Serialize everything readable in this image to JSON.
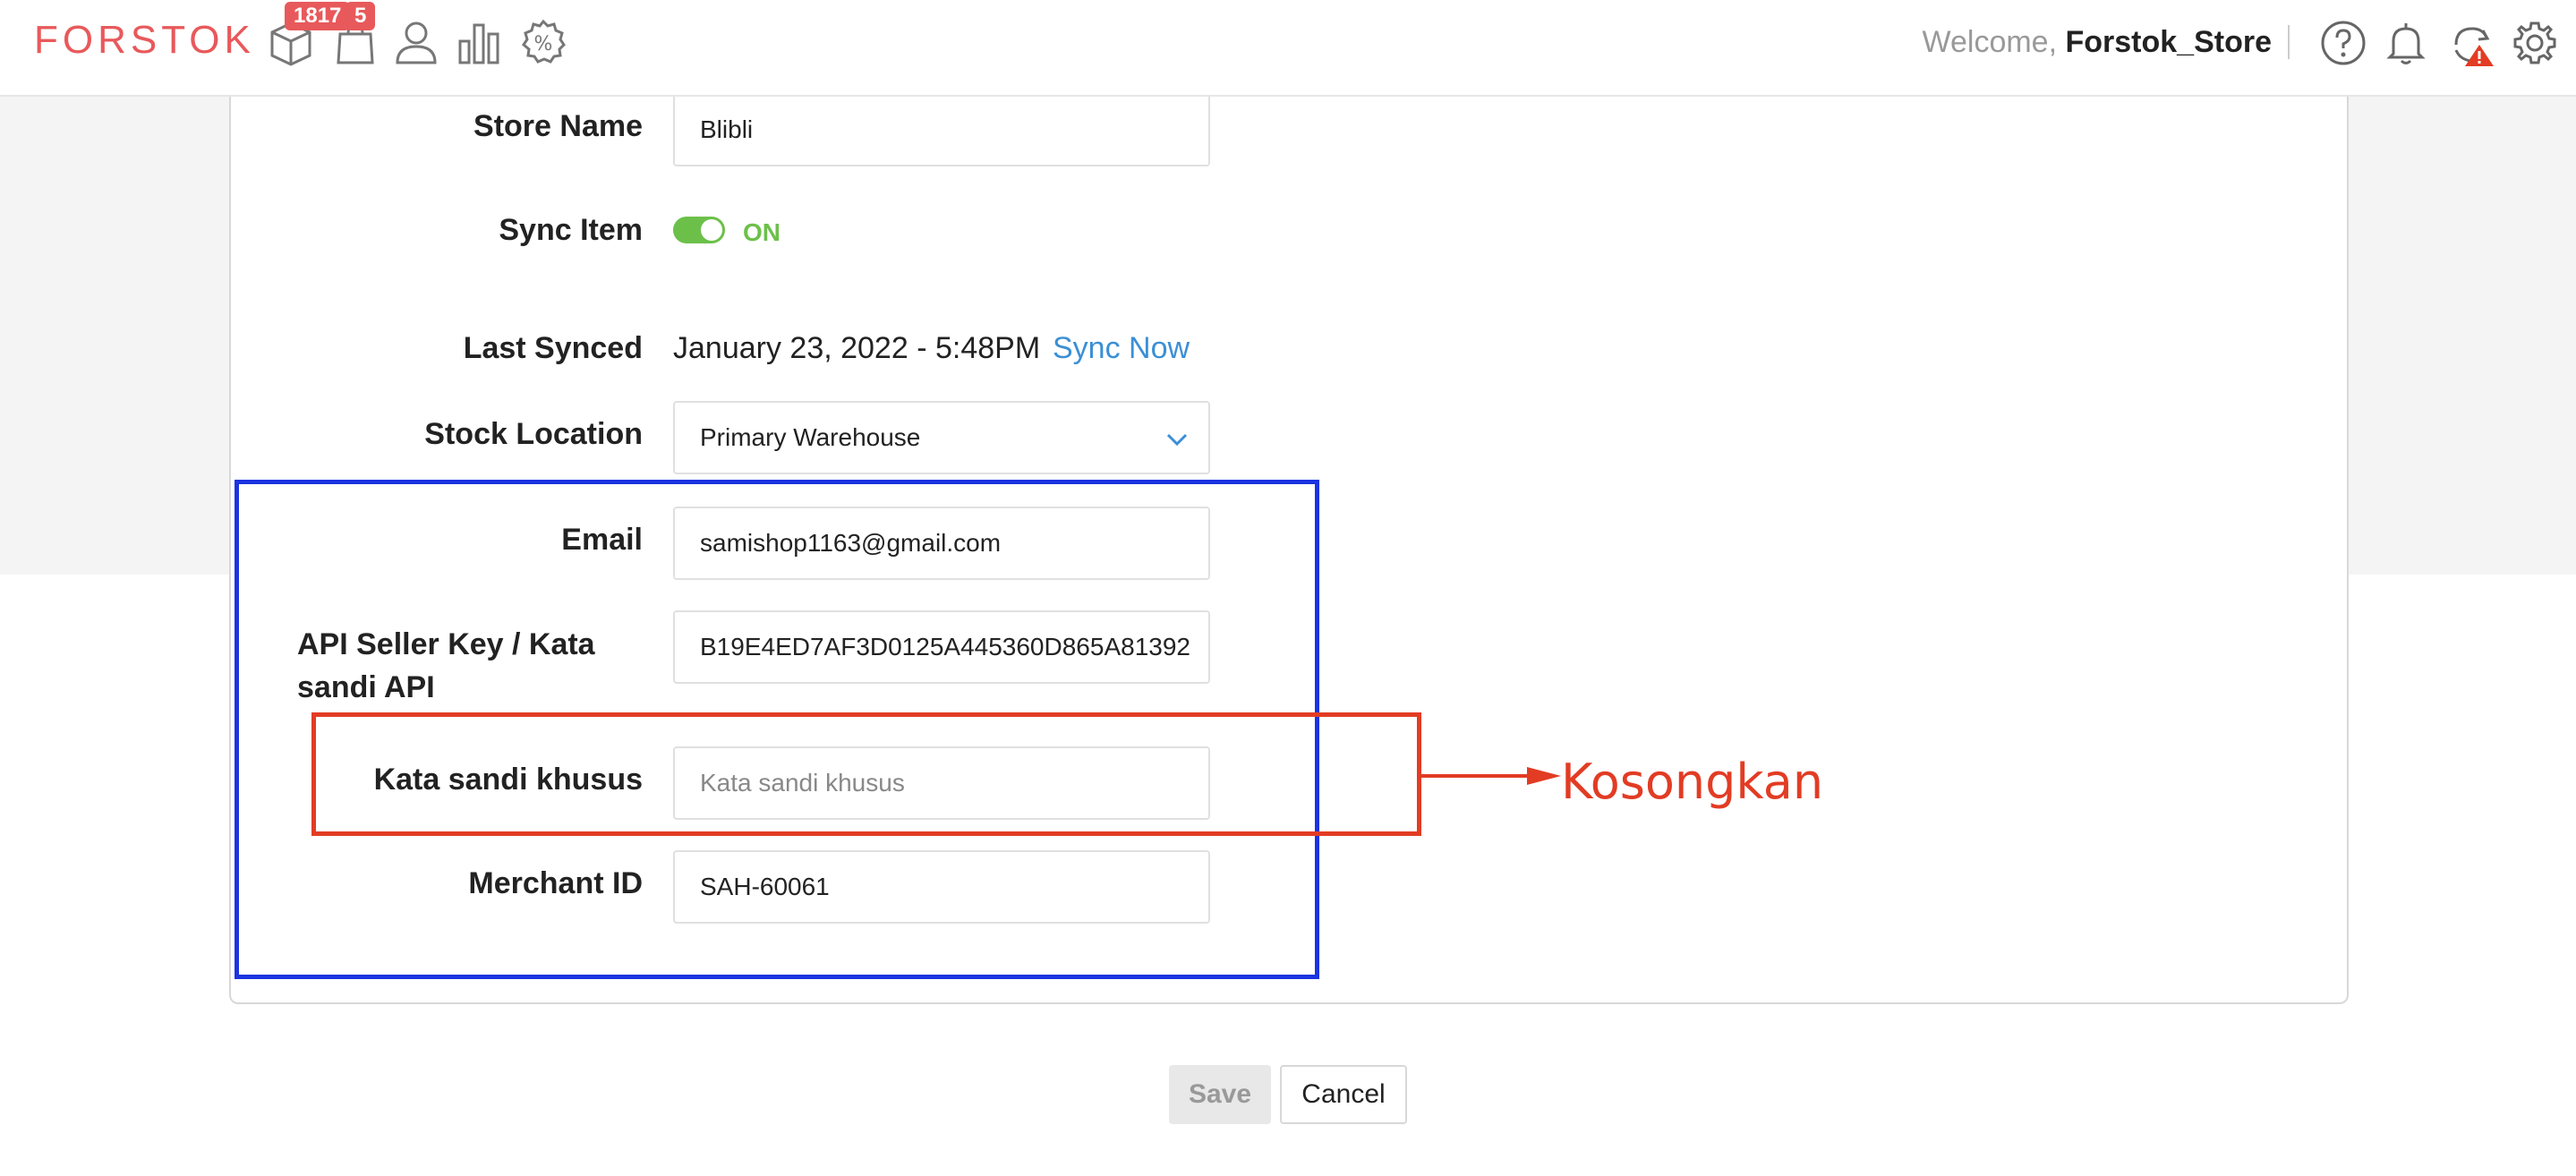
{
  "header": {
    "logo": "FORSTOK",
    "badges": {
      "orders": "1817",
      "bag": "5"
    },
    "welcome_prefix": "Welcome, ",
    "username": "Forstok_Store"
  },
  "form": {
    "store_name_label": "Store Name",
    "store_name_value": "Blibli",
    "sync_item_label": "Sync Item",
    "sync_item_state": "ON",
    "last_synced_label": "Last Synced",
    "last_synced_value": "January 23, 2022 - 5:48PM",
    "sync_now": "Sync Now",
    "stock_location_label": "Stock Location",
    "stock_location_value": "Primary Warehouse",
    "email_label": "Email",
    "email_value": "samishop1163@gmail.com",
    "api_key_label": "API Seller Key / Kata sandi API",
    "api_key_value": "B19E4ED7AF3D0125A445360D865A81392",
    "password_label": "Kata sandi khusus",
    "password_placeholder": "Kata sandi khusus",
    "merchant_label": "Merchant ID",
    "merchant_value": "SAH-60061"
  },
  "annotation": {
    "text": "Kosongkan"
  },
  "actions": {
    "save": "Save",
    "cancel": "Cancel"
  },
  "colors": {
    "brand": "#e8595b",
    "blue_box": "#1a34e0",
    "red_box": "#e23c24",
    "link": "#3b8fd6",
    "toggle_on": "#6cc04a"
  }
}
